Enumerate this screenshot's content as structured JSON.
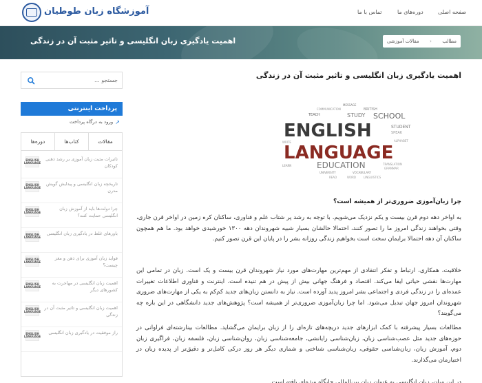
{
  "header": {
    "logo_text": "آموزشگاه زبان طوطیان",
    "nav": {
      "home": "صفحه اصلی",
      "courses": "دوره‌های ما",
      "contact": "تماس با ما"
    }
  },
  "banner": {
    "title": "اهمیت یادگیری زبان انگلیسی و تاثیر مثبت آن در زندگی",
    "breadcrumb": {
      "items": [
        "مطالب",
        "مقالات آموزشی"
      ],
      "separator": "‹"
    }
  },
  "sidebar": {
    "search": {
      "placeholder": "جستجو ..."
    },
    "payment": {
      "title": "پرداخت اینترنتی",
      "link": "ورود به درگاه پرداخت"
    },
    "tabs": [
      {
        "label": "مقالات"
      },
      {
        "label": "کتاب‌ها"
      },
      {
        "label": "دوره‌ها"
      }
    ],
    "posts": [
      {
        "title": "تاثیرات مثبت زبان آموزی بر رشد ذهنی کودکان",
        "thumb": "ENGLISH LANGUAGE"
      },
      {
        "title": "تاریخچه زبان انگلیسی و پیدایش گویش مدرن",
        "thumb": "ENGLISH LANGUAGE"
      },
      {
        "title": "چرا دولت‌ها باید از آموزش زبان انگلیسی حمایت کنند؟",
        "thumb": "ENGLISH LANGUAGE"
      },
      {
        "title": "باورهای غلط در یادگیری زبان انگلیسی",
        "thumb": "ENGLISH LANGUAGE"
      },
      {
        "title": "فواید زبان آموزی برای ذهن و مغز چیست؟",
        "thumb": "ENGLISH LANGUAGE"
      },
      {
        "title": "اهمیت زبان انگلیسی در مهاجرت به کشورهای دیگر",
        "thumb": "ENGLISH LANGUAGE"
      },
      {
        "title": "اهمیت زبان انگلیسی و تاثیر مثبت آن در زندگی",
        "thumb": "ENGLISH LANGUAGE"
      },
      {
        "title": "راز موفقیت در یادگیری زبان انگلیسی",
        "thumb": "ENGLISH LANGUAGE"
      }
    ]
  },
  "article": {
    "title": "اهمیت یادگیری زبان انگلیسی و تاثیر مثبت آن در زندگی",
    "image": {
      "word1": "ENGLISH",
      "word2": "LANGUAGE",
      "word3": "EDUCATION",
      "small_words": [
        "STUDY",
        "SCHOOL",
        "LEARN",
        "STUDENT",
        "COMMUNICATION",
        "TEACH",
        "MESSAGE",
        "LINGUISTICS",
        "SPEAK",
        "WRITE",
        "GRAMMAR",
        "TRANSLATION",
        "BRITISH",
        "VOCABULARY",
        "UNIVERSITY",
        "READ",
        "WORD",
        "ALPHABET"
      ]
    },
    "section_heading": "چرا زبان‌آموزی ضروری‌تر از همیشه است؟",
    "paragraphs": [
      "به اواخر دهه دوم قرن بیست و یکم نزدیک می‌شویم. با توجه به رشد پر شتاب علم و فناوری، ساکنان کره زمین در اواخر قرن جاری، وقتی بخواهند زندگی امروز ما را تصور کنند، احتمالا حالشان بسیار شبیه شهروندان دهه ۱۳۰۰ خورشیدی خواهد بود. ما هم همچون ساکنان آن دهه احتمالا برایمان سخت است بخواهیم زندگی روزانه بشر را در پایان این قرن تصور کنیم.",
      "خلاقیت، همکاری، ارتباط و تفکر انتقادی از مهم‌ترین مهارت‌های مورد نیاز شهروندان قرن بیست و یک است. زبان در تمامی این مهارت‌ها نقشی حیاتی ایفا می‌کند. اقتصاد و فرهنگ جهانی بیش از پیش در هم تنیده است. اینترنت و فناوری اطلاعات تغییرات عمده‌ای را در زندگی فردی و اجتماعی بشر امروز پدید آورده است. نیاز به دانستن زبان‌های جدید کم‌کم به یکی از مهارت‌های ضروری شهروندان امروز جهان تبدیل می‌شود. اما چرا زبان‌آموزی ضروری‌تر از همیشه است؟ پژوهش‌های جدید دانشگاهی در این باره چه می‌گویند؟",
      "مطالعات بسیار پیشرفته با کمک ابزارهای جدید دریچه‌های تازه‌ای را از زبان برایمان می‌گشاید. مطالعات بینارشته‌ای فراوانی در حوزه‌های جدید مثل عصب‌شناسی زبان، زبان‌شناسی رایانشی، جامعه‌شناسی زبان، روان‌شناسی زبان، فلسفه زبان، فراگیری زبان دوم، آموزش زبان، زبان‌شناسی حقوقی، زبان‌شناسی شناختی و شماری دیگر هر روز درکی کامل‌تر و دقیق‌تر از پدیده زبان در اختیارمان می‌گذارند.",
      "در این میان، زبان انگلیسی به عنوان زبان بین‌المللی جایگاه ویژه‌ای یافته است."
    ]
  },
  "colors": {
    "brand": "#2c5aa0",
    "pay_blue": "#1f7ad8",
    "banner_dark": "#2d4f5c"
  }
}
